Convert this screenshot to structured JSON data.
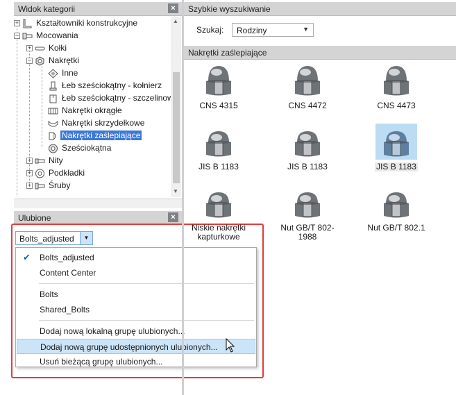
{
  "left_panel": {
    "title": "Widok kategorii",
    "tree": [
      {
        "label": "Kształtowniki konstrukcyjne",
        "icon": "structural-shape-icon",
        "expander": "+",
        "level": 0
      },
      {
        "label": "Mocowania",
        "icon": "fastener-icon",
        "expander": "-",
        "level": 0
      },
      {
        "label": "Kołki",
        "icon": "pin-icon",
        "expander": "+",
        "level": 1
      },
      {
        "label": "Nakrętki",
        "icon": "nut-icon",
        "expander": "-",
        "level": 1
      },
      {
        "label": "Inne",
        "icon": "diamond-icon",
        "expander": "",
        "level": 2
      },
      {
        "label": "Łeb sześciokątny - kołnierz",
        "icon": "hex-flange-nut-icon",
        "expander": "",
        "level": 2
      },
      {
        "label": "Łeb sześciokątny - szczelinowa",
        "icon": "hex-slotted-nut-icon",
        "expander": "",
        "level": 2
      },
      {
        "label": "Nakrętki okrągłe",
        "icon": "round-nut-icon",
        "expander": "",
        "level": 2
      },
      {
        "label": "Nakrętki skrzydełkowe",
        "icon": "wing-nut-icon",
        "expander": "",
        "level": 2
      },
      {
        "label": "Nakrętki zaślepiające",
        "icon": "cap-nut-icon",
        "expander": "",
        "level": 2,
        "selected": true
      },
      {
        "label": "Sześciokątna",
        "icon": "hex-nut-icon",
        "expander": "",
        "level": 2
      },
      {
        "label": "Nity",
        "icon": "rivet-icon",
        "expander": "+",
        "level": 1
      },
      {
        "label": "Podkładki",
        "icon": "washer-icon",
        "expander": "+",
        "level": 1
      },
      {
        "label": "Śruby",
        "icon": "bolt-icon",
        "expander": "+",
        "level": 1
      }
    ]
  },
  "favorites": {
    "title": "Ulubione",
    "selected": "Bolts_adjusted",
    "menu": [
      {
        "label": "Bolts_adjusted",
        "checked": true
      },
      {
        "label": "Content Center"
      },
      {
        "separator": true
      },
      {
        "label": "Bolts"
      },
      {
        "label": "Shared_Bolts"
      },
      {
        "separator": true
      },
      {
        "label": "Dodaj nową lokalną grupę ulubionych..."
      },
      {
        "label": "Dodaj nową grupę udostępnionych ulubionych...",
        "highlighted": true
      },
      {
        "label": "Usuń bieżącą grupę ulubionych..."
      }
    ]
  },
  "quick_search": {
    "title": "Szybkie wyszukiwanie",
    "label": "Szukaj:",
    "value": "Rodziny"
  },
  "results": {
    "title": "Nakrętki zaślepiające",
    "items": [
      {
        "label": "CNS 4315",
        "shape": "tall"
      },
      {
        "label": "CNS 4472",
        "shape": "tall"
      },
      {
        "label": "CNS 4473",
        "shape": "tall"
      },
      {
        "label": "JIS B 1183",
        "shape": "dome"
      },
      {
        "label": "JIS B 1183",
        "shape": "dome"
      },
      {
        "label": "JIS B 1183",
        "shape": "dome",
        "selected": true
      },
      {
        "label": "Niskie nakrętki kapturkowe",
        "shape": "dome"
      },
      {
        "label": "Nut GB/T 802-1988",
        "shape": "dome"
      },
      {
        "label": "Nut GB/T 802.1",
        "shape": "dome"
      }
    ]
  },
  "colors": {
    "selection": "#3b78d8",
    "highlight": "#cce4f7",
    "annotation": "#e03c3c"
  }
}
